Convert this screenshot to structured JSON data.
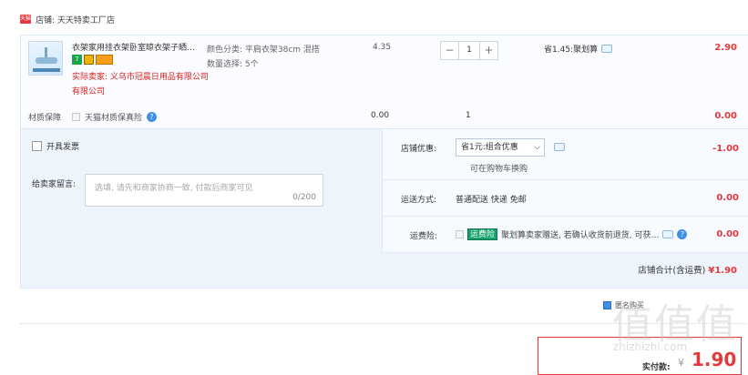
{
  "shop": {
    "logo_text": "天猫",
    "label": "店铺: 天天特卖工厂店"
  },
  "product": {
    "title": "衣架家用挂衣架卧室晾衣架子晒…",
    "badge_7": "7",
    "seller_label": "实际卖家: 义乌市冠晨日用品有限公司有限公司",
    "spec_line1": "颜色分类: 平肩衣架38cm 混搭",
    "spec_line2": "数量选择: 5个",
    "unit_price": "4.35",
    "qty_minus": "−",
    "quantity": "1",
    "qty_plus": "+",
    "saving": "省1.45:聚划算",
    "subtotal": "2.90"
  },
  "insurance": {
    "label": "材质保障",
    "option": "天猫材质保真险",
    "help": "?",
    "price": "0.00",
    "qty": "1",
    "total": "0.00"
  },
  "invoice": {
    "label": "开具发票"
  },
  "message": {
    "label": "给卖家留言:",
    "placeholder": "选填, 请先和商家协商一致, 付款后商家可见",
    "count": "0/200"
  },
  "discount": {
    "label": "店铺优惠:",
    "selected": "省1元:组合优惠",
    "note": "可在购物车换购",
    "amount": "-1.00"
  },
  "shipping": {
    "label": "运送方式:",
    "method": "普通配送 快递 免邮",
    "amount": "0.00"
  },
  "freight_ins": {
    "label": "运费险:",
    "tag": "运费险",
    "text": "聚划算卖家赠送, 若确认收货前退货, 可获…",
    "amount": "0.00"
  },
  "shop_total": {
    "label": "店铺合计(含运费)",
    "amount": "¥1.90"
  },
  "bottom": {
    "anon": "匿名购买",
    "pay_label": "实付款:",
    "pay_yen": "¥",
    "pay_value": "1.90"
  },
  "watermark": {
    "big": "值值值",
    "small": "zhizhizhi.com"
  },
  "colors": {
    "accent": "#e4393c",
    "blue": "#3e8fe8",
    "green": "#13a06a"
  }
}
